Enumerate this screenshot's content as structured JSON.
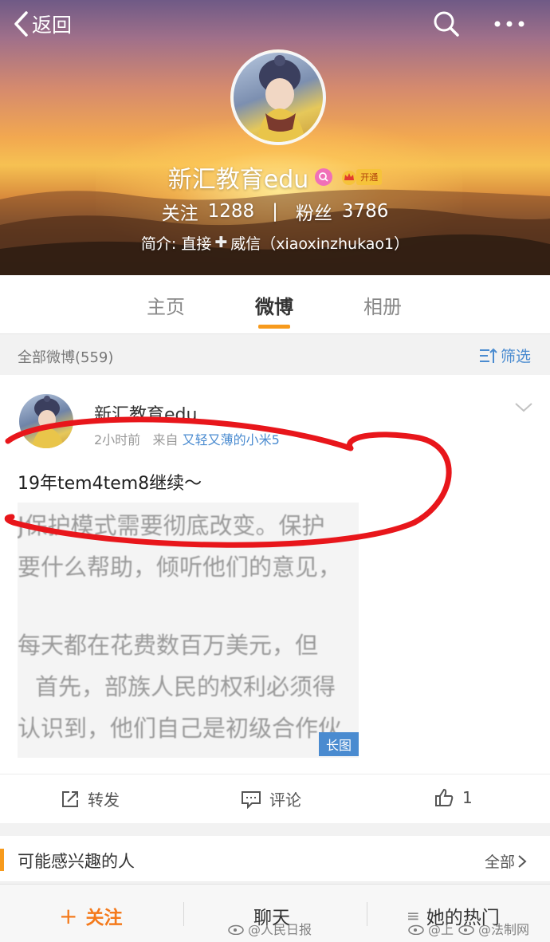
{
  "topbar": {
    "back_label": "返回",
    "search_icon": "search-icon",
    "more_icon": "more-icon"
  },
  "profile": {
    "name": "新汇教育edu",
    "vip_label": "开通",
    "following_label": "关注",
    "following_count": "1288",
    "separator": "|",
    "followers_label": "粉丝",
    "followers_count": "3786",
    "bio_prefix": "简介: 直接",
    "bio_plus": "✚",
    "bio_suffix": "威信（xiaoxinzhukao1）"
  },
  "tabs": [
    {
      "label": "主页"
    },
    {
      "label": "微博",
      "active": true
    },
    {
      "label": "相册"
    }
  ],
  "filter": {
    "count_label": "全部微博(559)",
    "filter_label": "筛选"
  },
  "post": {
    "author": "新汇教育edu",
    "time": "2小时前",
    "source_prefix": "来自",
    "source": "又轻又薄的小米5",
    "text": "19年tem4tem8继续～",
    "image_lines": [
      "J保护模式需要彻底改变。保护",
      "要什么帮助，倾听他们的意见，",
      "",
      "每天都在花费数百万美元，但",
      "首先，部族人民的权利必须得",
      "认识到，他们自己是初级合作伙"
    ],
    "image_badge": "长图",
    "actions": {
      "repost": "转发",
      "comment": "评论",
      "like": "1"
    }
  },
  "interest": {
    "title": "可能感兴趣的人",
    "all_label": "全部"
  },
  "bottombar": {
    "follow": "关注",
    "follow_plus": "+",
    "chat": "聊天",
    "hot": "她的热门",
    "hot_icon_text": "≡"
  },
  "watermarks": {
    "left": "@人民日报",
    "right_1": "@上",
    "right_2": "@法制网"
  },
  "colors": {
    "accent_orange": "#f79a1c",
    "link_blue": "#4a8bd0",
    "annotation_red": "#e8161b"
  }
}
